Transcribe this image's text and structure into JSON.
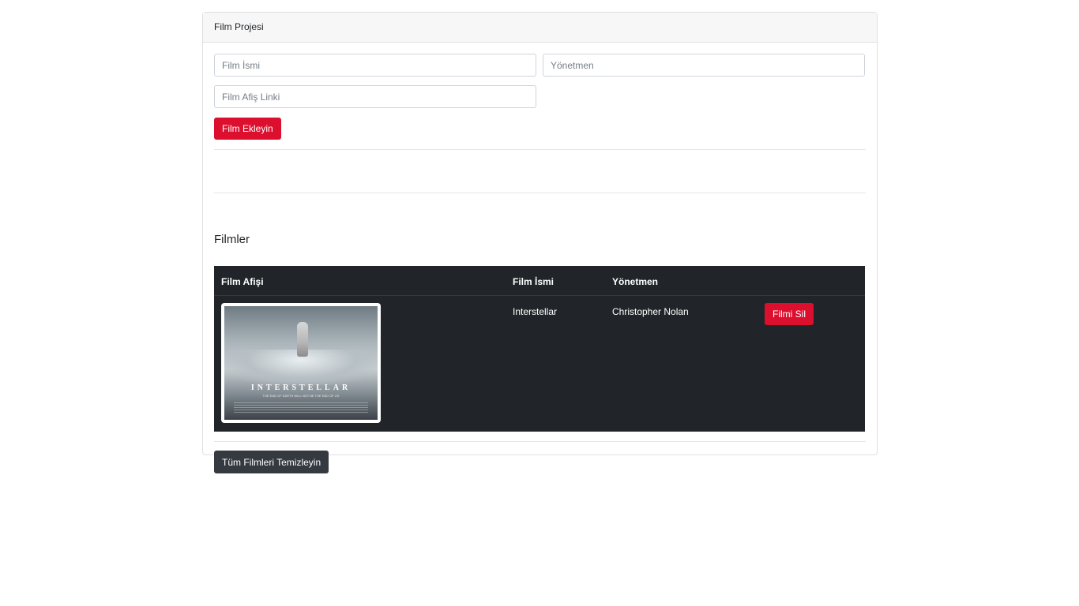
{
  "card": {
    "header_title": "Film Projesi"
  },
  "form": {
    "film_name_placeholder": "Film İsmi",
    "director_placeholder": "Yönetmen",
    "poster_link_placeholder": "Film Afiş Linki",
    "add_button_label": "Film Ekleyin"
  },
  "films_section": {
    "title": "Filmler",
    "columns": [
      "Film Afişi",
      "Film İsmi",
      "Yönetmen"
    ],
    "rows": [
      {
        "poster_title": "INTERSTELLAR",
        "poster_tagline": "THE END OF EARTH WILL NOT BE THE END OF US",
        "name": "Interstellar",
        "director": "Christopher Nolan",
        "delete_label": "Filmi Sil"
      }
    ]
  },
  "clear_button_label": "Tüm Filmleri Temizleyin",
  "colors": {
    "danger": "#dc0f2e",
    "dark": "#343a40",
    "table_bg": "#212529"
  }
}
